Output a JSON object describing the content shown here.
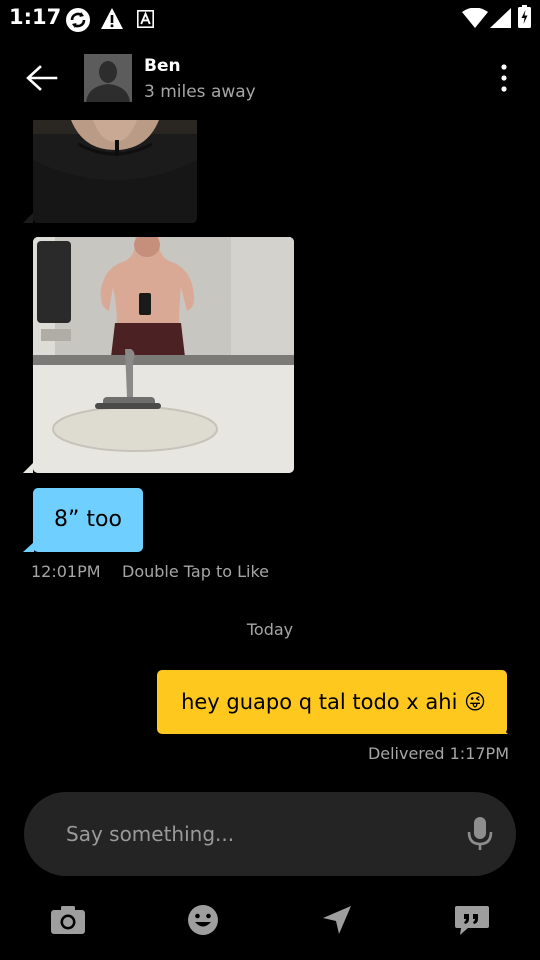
{
  "status_bar": {
    "time": "1:17"
  },
  "header": {
    "name": "Ben",
    "distance": "3 miles away"
  },
  "messages": {
    "incoming_text": "8” too",
    "incoming_time": "12:01PM",
    "incoming_hint": "Double Tap to Like",
    "date_divider": "Today",
    "outgoing_text": "hey guapo q tal todo x ahi 😜",
    "outgoing_status": "Delivered 1:17PM"
  },
  "composer": {
    "placeholder": "Say something..."
  },
  "colors": {
    "background": "#000000",
    "incoming_bubble": "#6fd0ff",
    "outgoing_bubble": "#ffc81f",
    "composer_bg": "#242424",
    "secondary_text": "#a6a6a6",
    "toolbar_icons": "#9e9e9e"
  },
  "toolbar": {
    "icons": [
      "camera-icon",
      "smiley-icon",
      "location-icon",
      "quick-phrases-icon"
    ]
  }
}
